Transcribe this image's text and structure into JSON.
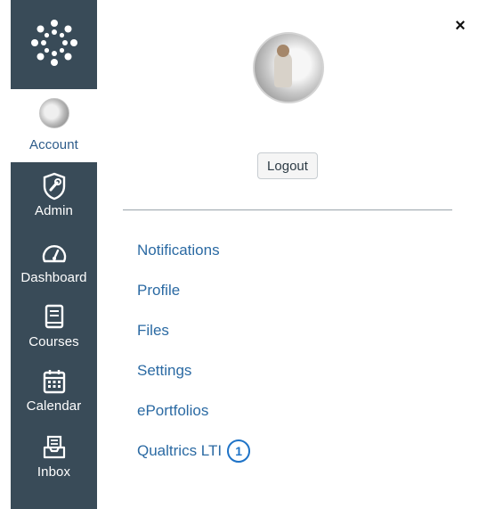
{
  "nav": {
    "logo_icon": "canvas-logo-icon",
    "items": [
      {
        "label": "Account",
        "icon": "user-avatar",
        "active": true
      },
      {
        "label": "Admin",
        "icon": "admin-shield-icon"
      },
      {
        "label": "Dashboard",
        "icon": "dashboard-gauge-icon"
      },
      {
        "label": "Courses",
        "icon": "courses-book-icon"
      },
      {
        "label": "Calendar",
        "icon": "calendar-icon"
      },
      {
        "label": "Inbox",
        "icon": "inbox-icon"
      }
    ]
  },
  "tray": {
    "close_label": "×",
    "logout_label": "Logout",
    "links": [
      {
        "label": "Notifications"
      },
      {
        "label": "Profile"
      },
      {
        "label": "Files"
      },
      {
        "label": "Settings"
      },
      {
        "label": "ePortfolios"
      },
      {
        "label": "Qualtrics LTI",
        "callout": "1"
      }
    ]
  },
  "colors": {
    "nav_bg": "#394b58",
    "link": "#2b6aa3",
    "callout": "#1e73c7",
    "account_label": "#2c5b8a"
  }
}
